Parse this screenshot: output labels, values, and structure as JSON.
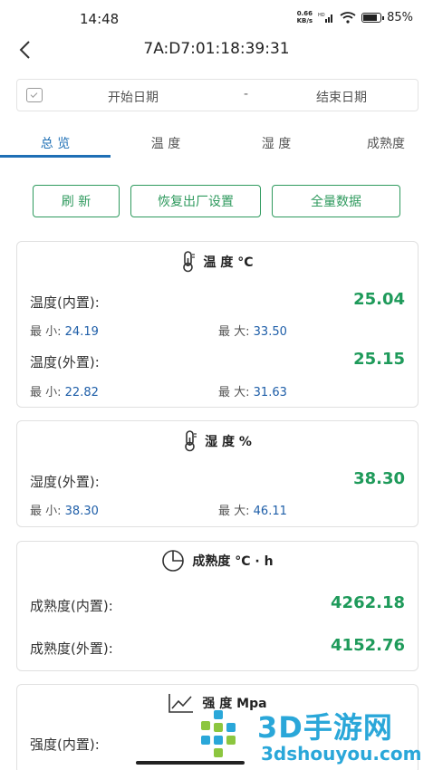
{
  "status_bar": {
    "time": "14:48",
    "net_speed_top": "0.66",
    "net_speed_bottom": "KB/s",
    "battery": "85%",
    "battery_level": 0.85
  },
  "header": {
    "back_icon": "chevron-left-icon",
    "title": "7A:D7:01:18:39:31"
  },
  "date_range": {
    "start_placeholder": "开始日期",
    "separator": "-",
    "end_placeholder": "结束日期",
    "icon": "calendar-icon"
  },
  "tabs": [
    {
      "label": "总 览",
      "active": true
    },
    {
      "label": "温 度",
      "active": false
    },
    {
      "label": "湿 度",
      "active": false
    },
    {
      "label": "成熟度",
      "active": false
    }
  ],
  "actions": {
    "refresh": "刷 新",
    "factory_reset": "恢复出厂设置",
    "all_data": "全量数据"
  },
  "colors": {
    "accent_green": "#2f9a5e",
    "value_green": "#1e9a5a",
    "tab_blue": "#1e6fb5",
    "minmax_blue": "#1e5ea8"
  },
  "temperature_card": {
    "title": "温 度 °C",
    "icon": "thermometer-icon",
    "internal_label": "温度(内置):",
    "internal_value": "25.04",
    "internal_min_label": "最 小:",
    "internal_min": "24.19",
    "internal_max_label": "最 大:",
    "internal_max": "33.50",
    "external_label": "温度(外置):",
    "external_value": "25.15",
    "external_min_label": "最 小:",
    "external_min": "22.82",
    "external_max_label": "最 大:",
    "external_max": "31.63"
  },
  "humidity_card": {
    "title": "湿 度 %",
    "icon": "thermometer-icon",
    "external_label": "湿度(外置):",
    "external_value": "38.30",
    "min_label": "最 小:",
    "min": "38.30",
    "max_label": "最 大:",
    "max": "46.11"
  },
  "maturity_card": {
    "title": "成熟度 °C · h",
    "icon": "pie-chart-icon",
    "internal_label": "成熟度(内置):",
    "internal_value": "4262.18",
    "external_label": "成熟度(外置):",
    "external_value": "4152.76"
  },
  "strength_card": {
    "title": "强 度 Mpa",
    "icon": "line-chart-icon",
    "internal_label": "强度(内置):"
  },
  "watermark": {
    "title": "3D手游网",
    "url": "3dshouyou.com"
  }
}
